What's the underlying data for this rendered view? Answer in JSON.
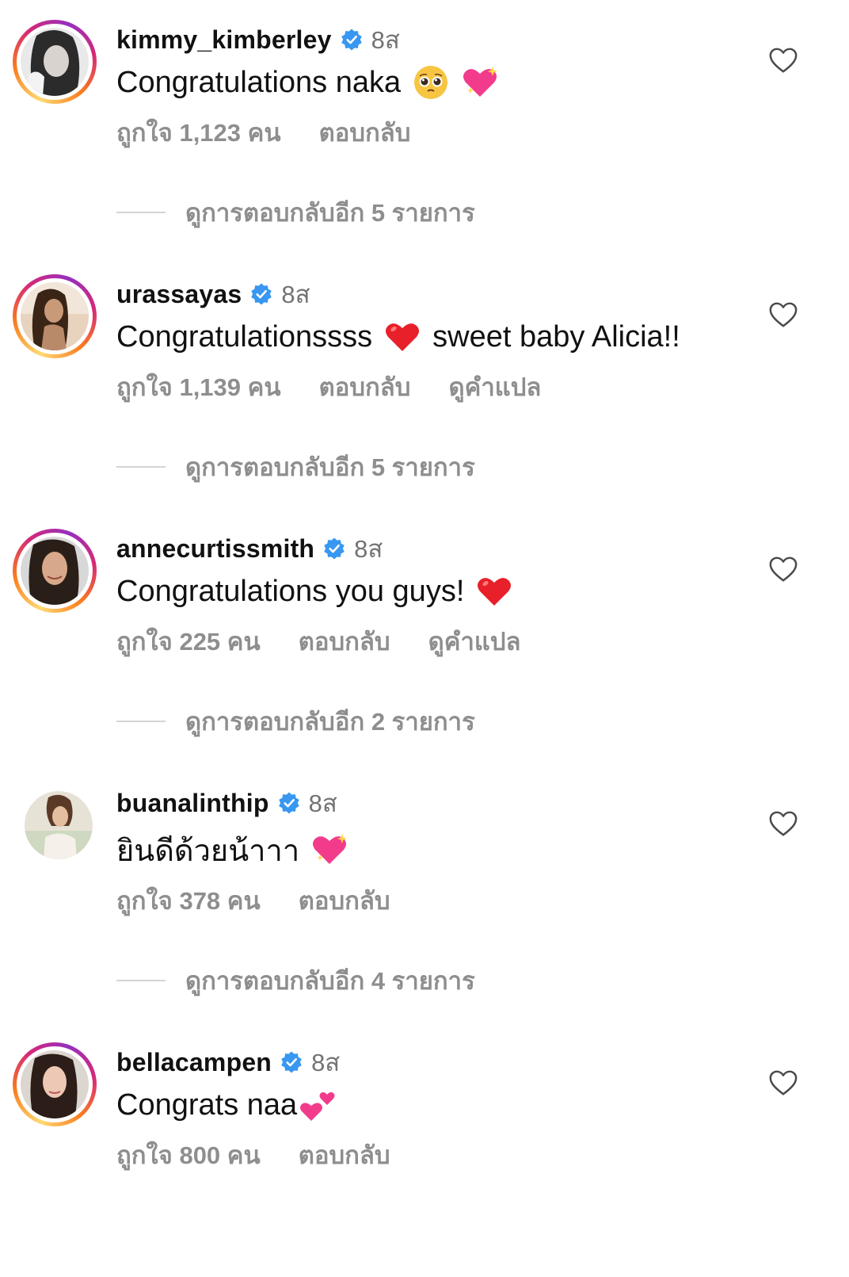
{
  "colors": {
    "verified": "#3897f0",
    "secondary_text": "#8e8e8e",
    "time_text": "#737373",
    "primary_text": "#111111"
  },
  "comments": [
    {
      "username": "kimmy_kimberley",
      "time": "8ส",
      "text": "Congratulations naka",
      "emojis": [
        "pleading-face-emoji",
        "sparkling-heart-emoji"
      ],
      "likes": "ถูกใจ 1,123 คน",
      "reply": "ตอบกลับ",
      "translate": null,
      "view_replies": "ดูการตอบกลับอีก 5 รายการ",
      "story_ring": true
    },
    {
      "username": "urassayas",
      "time": "8ส",
      "text": "Congratulationssss",
      "emojis": [
        "red-heart-emoji"
      ],
      "text_after": "sweet baby Alicia!!",
      "likes": "ถูกใจ 1,139 คน",
      "reply": "ตอบกลับ",
      "translate": "ดูคำแปล",
      "view_replies": "ดูการตอบกลับอีก 5 รายการ",
      "story_ring": true
    },
    {
      "username": "annecurtissmith",
      "time": "8ส",
      "text": "Congratulations you guys!",
      "emojis": [
        "red-heart-emoji"
      ],
      "likes": "ถูกใจ 225 คน",
      "reply": "ตอบกลับ",
      "translate": "ดูคำแปล",
      "view_replies": "ดูการตอบกลับอีก 2 รายการ",
      "story_ring": true
    },
    {
      "username": "buanalinthip",
      "time": "8ส",
      "text": "ยินดีด้วยน้าาา",
      "emojis": [
        "sparkling-heart-emoji"
      ],
      "likes": "ถูกใจ 378 คน",
      "reply": "ตอบกลับ",
      "translate": null,
      "view_replies": "ดูการตอบกลับอีก 4 รายการ",
      "story_ring": false
    },
    {
      "username": "bellacampen",
      "time": "8ส",
      "text": "Congrats naa",
      "emojis": [
        "two-hearts-emoji"
      ],
      "likes": "ถูกใจ 800 คน",
      "reply": "ตอบกลับ",
      "translate": null,
      "view_replies": null,
      "story_ring": true
    }
  ]
}
